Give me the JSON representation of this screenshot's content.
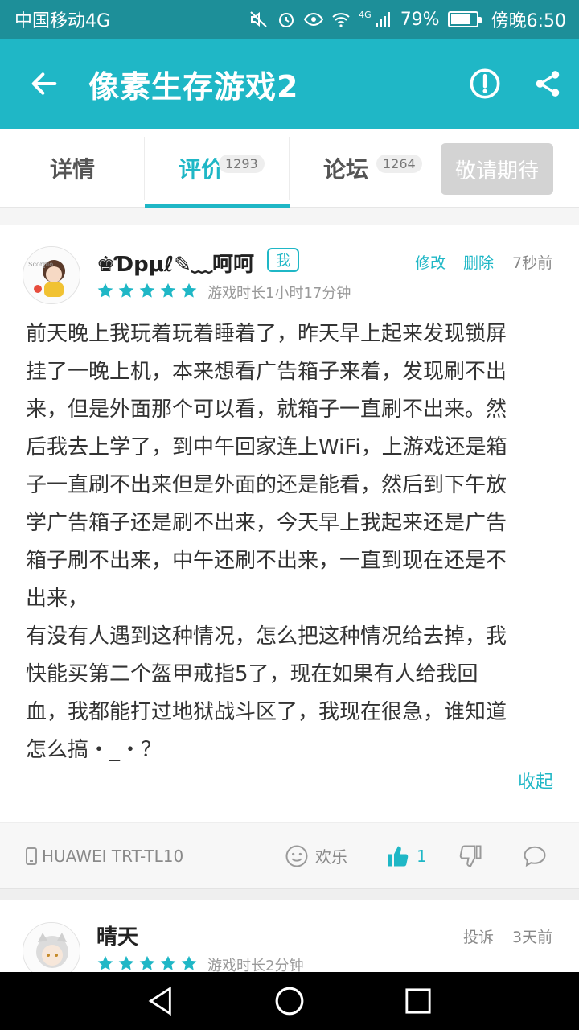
{
  "status_bar": {
    "carrier": "中国移动4G",
    "network": "4G",
    "battery": "79%",
    "battery_level": 0.79,
    "time": "傍晚6:50"
  },
  "title_bar": {
    "title": "像素生存游戏2",
    "icons": [
      "back-arrow-icon",
      "report-icon",
      "share-icon"
    ]
  },
  "tabs": [
    {
      "label": "详情",
      "badge": ""
    },
    {
      "label": "评价",
      "badge": "1293",
      "active": true
    },
    {
      "label": "论坛",
      "badge": "1264"
    }
  ],
  "expect_button": "敬请期待",
  "reviews": [
    {
      "username": "♚Ɗpμℓ✎﹏呵呵",
      "me_tag": "我",
      "actions": [
        "修改",
        "删除"
      ],
      "time_ago": "7秒前",
      "rating": 5,
      "playtime": "游戏时长1小时17分钟",
      "text": "前天晚上我玩着玩着睡着了，昨天早上起来发现锁屏\n挂了一晚上机，本来想看广告箱子来着，发现刷不出\n来，但是外面那个可以看，就箱子一直刷不出来。然\n后我去上学了，到中午回家连上WiFi，上游戏还是箱\n子一直刷不出来但是外面的还是能看，然后到下午放\n学广告箱子还是刷不出来，今天早上我起来还是广告\n箱子刷不出来，中午还刷不出来，一直到现在还是不\n出来，\n有没有人遇到这种情况，怎么把这种情况给去掉，我\n快能买第二个盔甲戒指5了，现在如果有人给我回\n血，我都能打过地狱战斗区了，我现在很急，谁知道\n怎么搞・_・？",
      "collapse": "收起",
      "device": "HUAWEI TRT-TL10",
      "mood": "欢乐",
      "likes": "1"
    },
    {
      "username": "晴天",
      "actions": [
        "投诉"
      ],
      "time_ago": "3天前",
      "rating": 5,
      "playtime": "游戏时长2分钟"
    }
  ],
  "colors": {
    "accent": "#1fb7c6",
    "status_bar": "#1d8f99",
    "star": "#1fb7c6"
  }
}
